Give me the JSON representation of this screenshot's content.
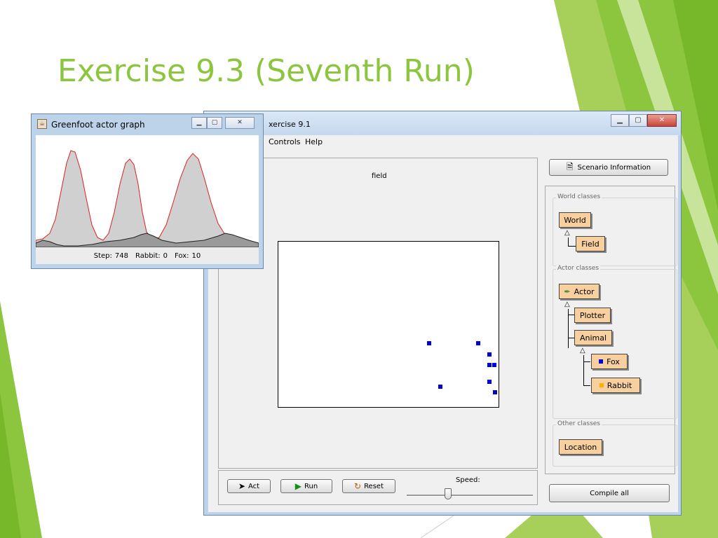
{
  "slide": {
    "title": "Exercise 9.3 (Seventh Run)",
    "accent_color": "#8cc63f"
  },
  "main_window": {
    "title": "xercise 9.1",
    "buttons": {
      "minimize_icon": "minimize-icon",
      "maximize_icon": "maximize-icon",
      "close_icon": "close-icon"
    },
    "menu": [
      "Controls",
      "Help"
    ],
    "world_label": "field",
    "controls": {
      "act_label": "Act",
      "run_label": "Run",
      "reset_label": "Reset",
      "speed_label": "Speed:",
      "speed_level": 0.33
    },
    "scenario_button_label": "Scenario Information",
    "compile_button_label": "Compile all",
    "groups": {
      "world": {
        "legend": "World classes",
        "classes": [
          "World",
          "Field"
        ]
      },
      "actor": {
        "legend": "Actor classes",
        "classes": [
          "Actor",
          "Plotter",
          "Animal",
          "Fox",
          "Rabbit"
        ]
      },
      "other": {
        "legend": "Other classes",
        "classes": [
          "Location"
        ]
      }
    },
    "fox_color": "#0000dd",
    "rabbit_color": "#ffb000",
    "class_box_color": "#f8cf9e"
  },
  "graph_window": {
    "title": "Greenfoot actor graph",
    "status": {
      "step_label": "Step:",
      "step_value": "748",
      "rabbit_label": "Rabbit:",
      "rabbit_value": "0",
      "fox_label": "Fox:",
      "fox_value": "10"
    },
    "rabbit_line_color": "#dd2020",
    "fox_line_color": "#202020"
  }
}
